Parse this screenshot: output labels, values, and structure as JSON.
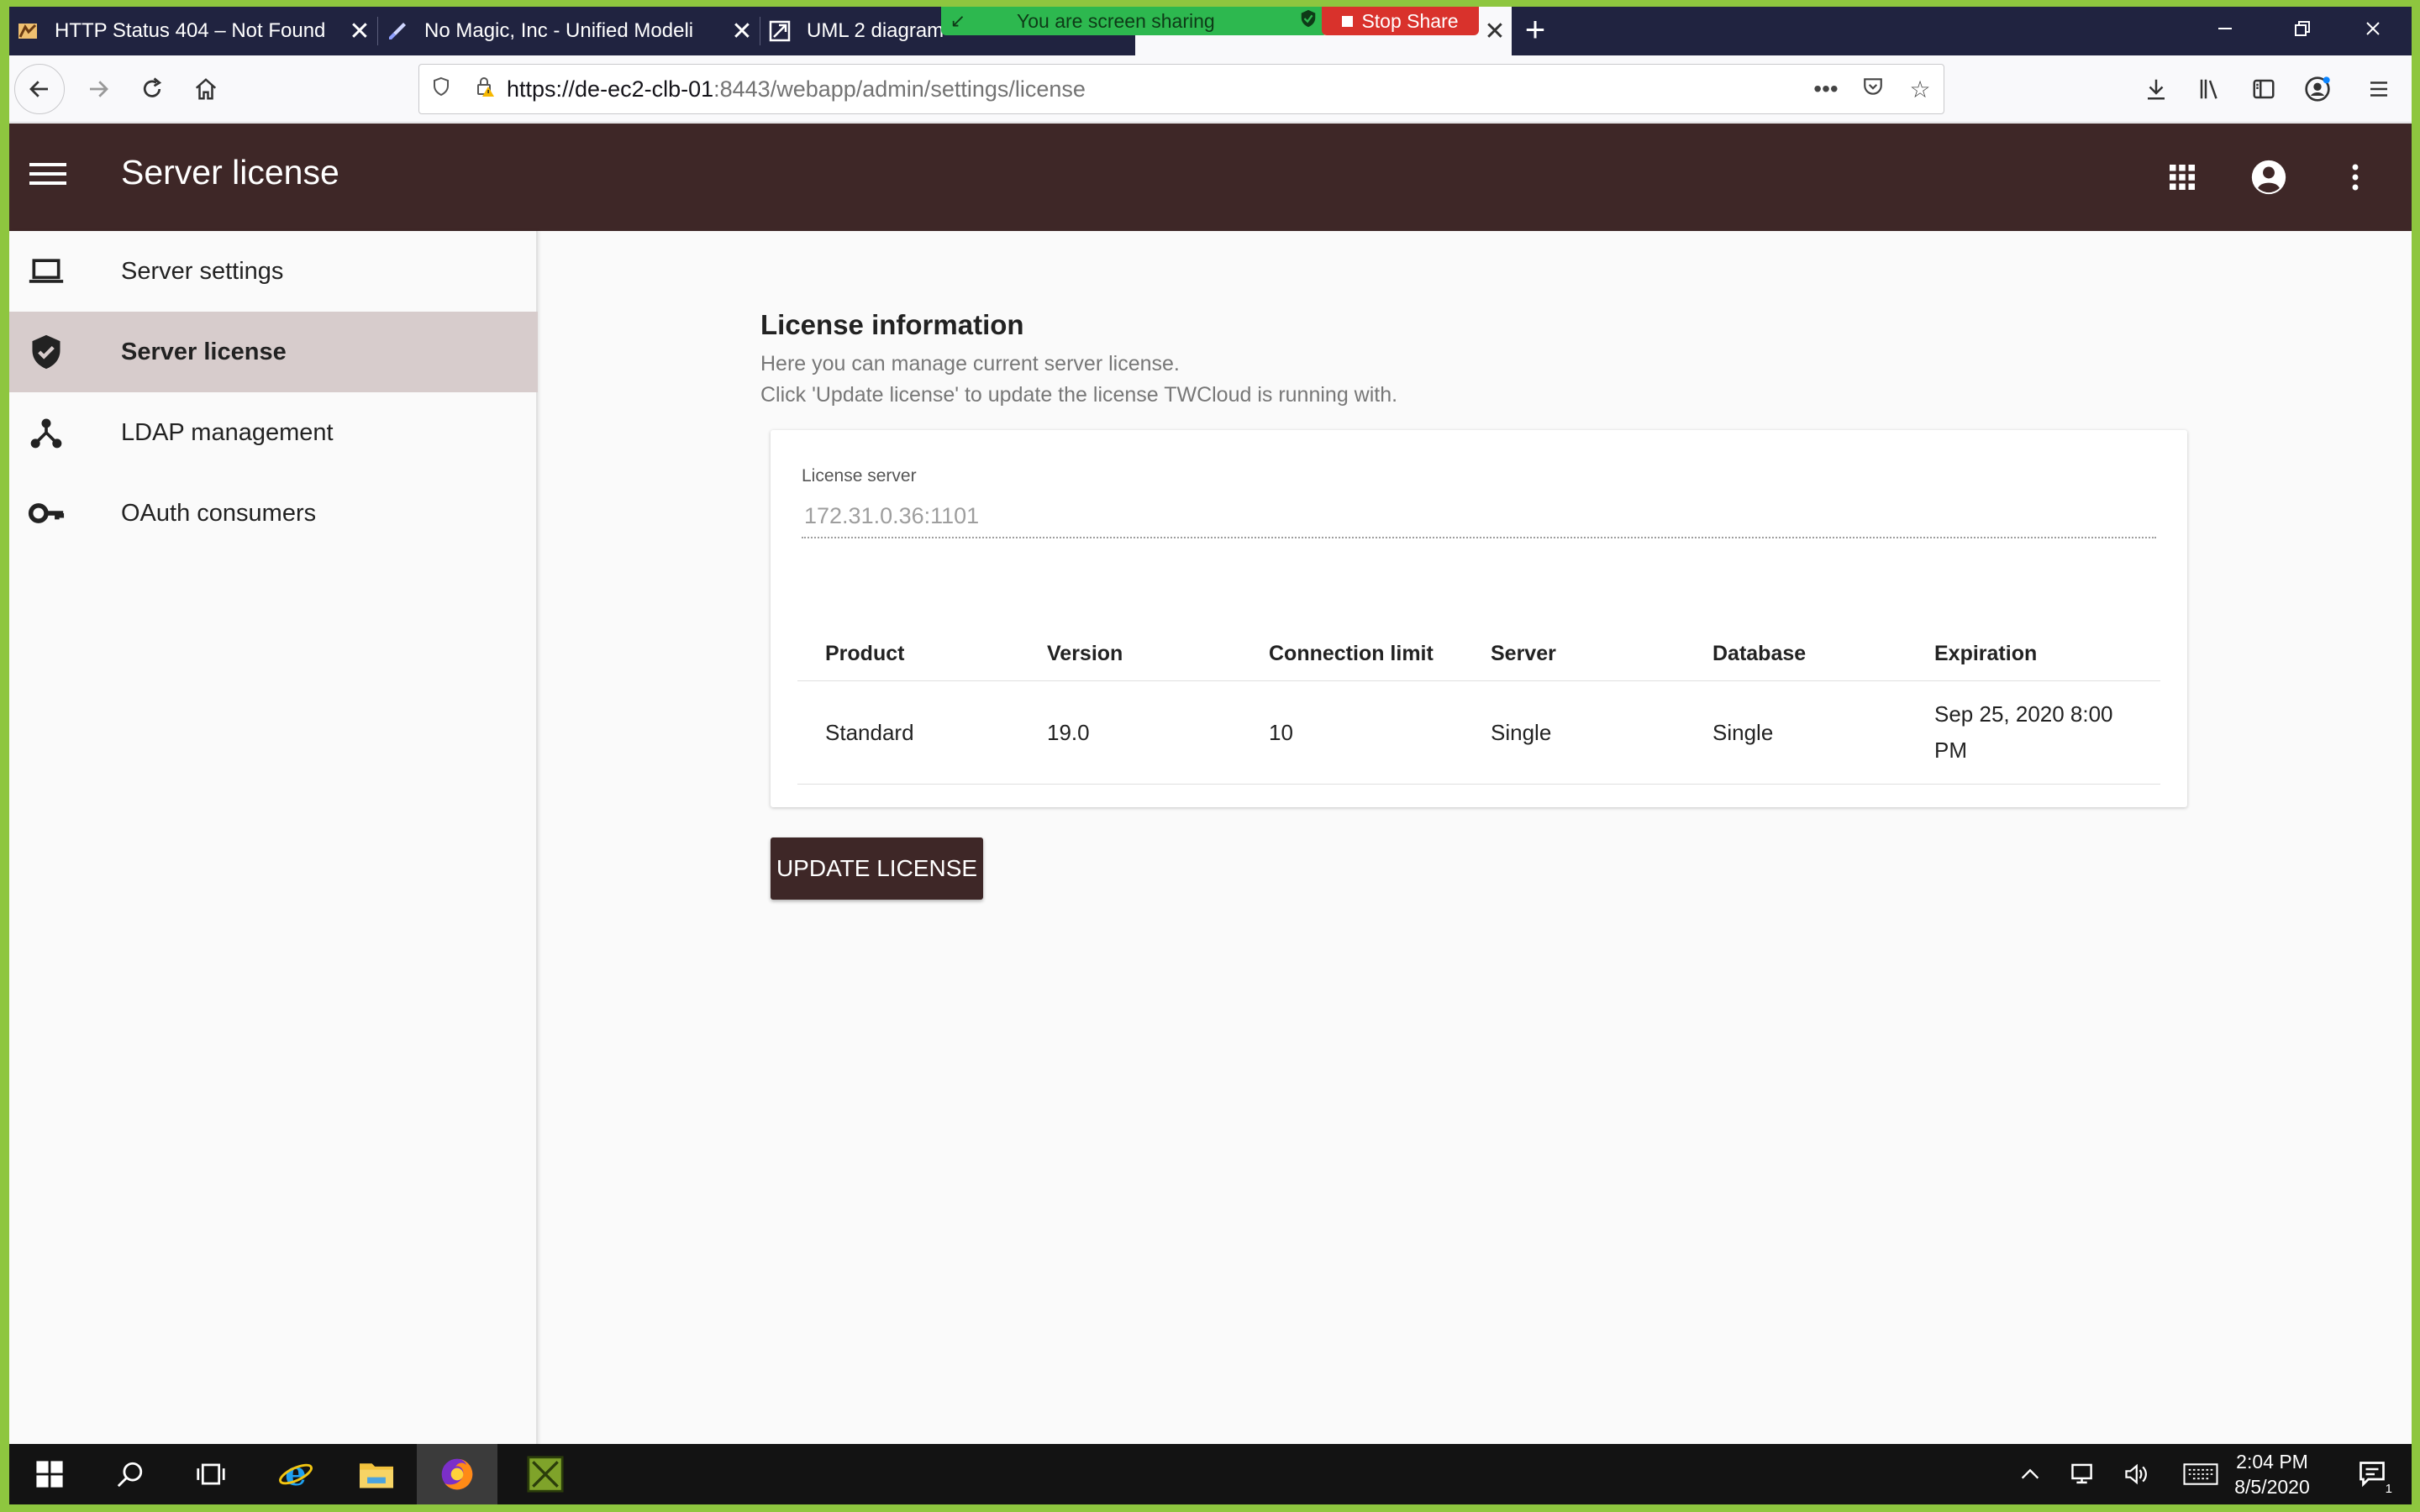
{
  "browser": {
    "tabs": [
      {
        "title": "HTTP Status 404 – Not Found",
        "active": false
      },
      {
        "title": "No Magic, Inc - Unified Modeli",
        "active": false
      },
      {
        "title": "UML 2 diagram",
        "active": false
      },
      {
        "title": "",
        "active": true
      }
    ],
    "new_tab_label": "+",
    "url_host": "https://de-ec2-clb-01",
    "url_path": ":8443/webapp/admin/settings/license",
    "url_actions": [
      "more-icon",
      "pocket-icon",
      "bookmark-star-icon"
    ],
    "toolbar_icons": [
      "download-icon",
      "library-icon",
      "sidebar-icon",
      "account-icon",
      "hamburger-menu-icon"
    ]
  },
  "screen_share": {
    "banner_text": "You are screen sharing",
    "stop_label": "Stop Share"
  },
  "app": {
    "title": "Server license",
    "right_icons": [
      "apps-grid-icon",
      "account-circle-icon",
      "more-vert-icon"
    ]
  },
  "sidebar": {
    "items": [
      {
        "label": "Server settings",
        "icon": "laptop-icon",
        "active": false
      },
      {
        "label": "Server license",
        "icon": "shield-check-icon",
        "active": true
      },
      {
        "label": "LDAP management",
        "icon": "hub-icon",
        "active": false
      },
      {
        "label": "OAuth consumers",
        "icon": "key-icon",
        "active": false
      }
    ]
  },
  "license": {
    "heading": "License information",
    "desc_line1": "Here you can manage current server license.",
    "desc_line2": "Click 'Update license' to update the license TWCloud is running with.",
    "server_label": "License server",
    "server_value": "172.31.0.36:1101",
    "columns": [
      "Product",
      "Version",
      "Connection limit",
      "Server",
      "Database",
      "Expiration"
    ],
    "rows": [
      [
        "Standard",
        "19.0",
        "10",
        "Single",
        "Single",
        "Sep 25, 2020 8:00 PM"
      ]
    ],
    "update_button": "UPDATE LICENSE"
  },
  "taskbar": {
    "time": "2:04 PM",
    "date": "8/5/2020",
    "notification_count": "1"
  },
  "colors": {
    "appbar": "#3e2727",
    "sidebar_active": "#d7cccc",
    "tabstrip": "#202340",
    "screen_share_border": "#8ec63f",
    "share_banner": "#2db84f",
    "stop_share": "#d9322c"
  }
}
